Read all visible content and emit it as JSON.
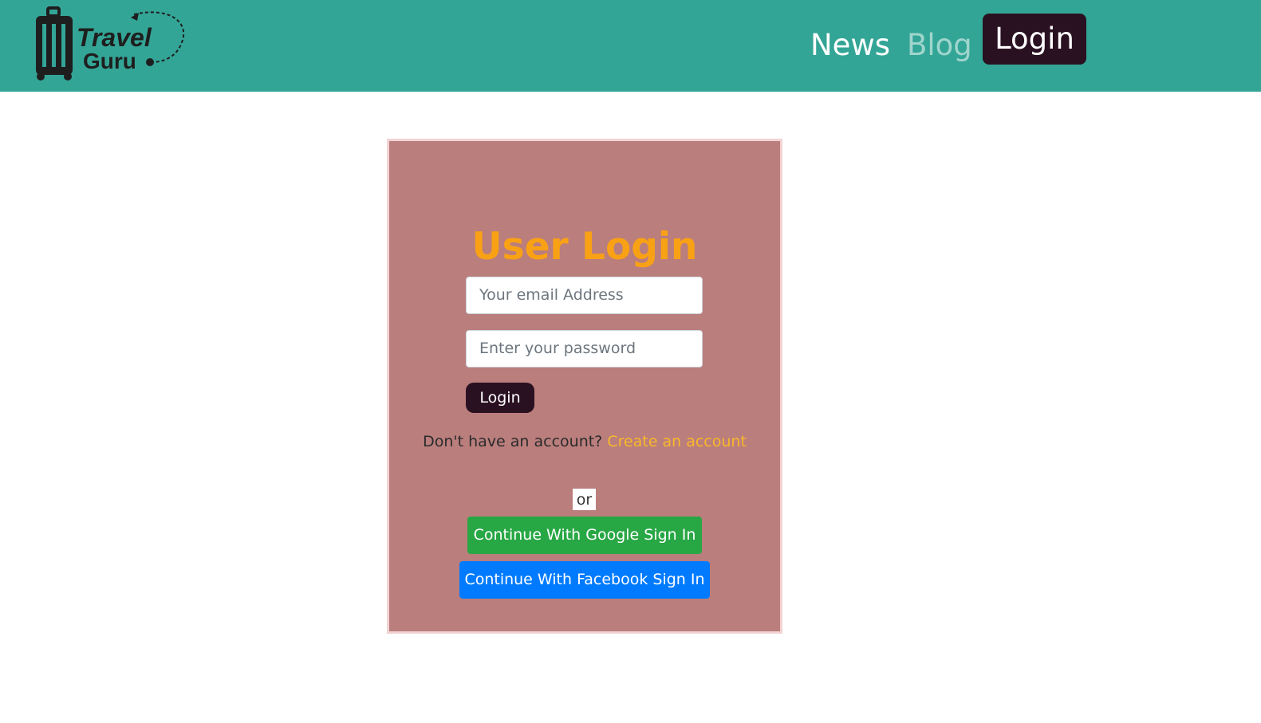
{
  "header": {
    "logo": {
      "line1": "Travel",
      "line2": "Guru"
    },
    "nav": {
      "news": "News",
      "blog": "Blog",
      "login": "Login"
    }
  },
  "login_card": {
    "title": "User Login",
    "email_placeholder": "Your  email Address",
    "password_placeholder": "Enter your password",
    "login_button": "Login",
    "no_account_text": "Don't have an account? ",
    "create_account_link": "Create an account",
    "or_text": "or",
    "google_button": "Continue With Google Sign In",
    "facebook_button": "Continue With Facebook Sign In"
  },
  "colors": {
    "navbar_bg": "#33a596",
    "card_bg": "#ba7e7d",
    "title_color": "#f9a115",
    "button_dark": "#2a1121",
    "google_green": "#28a745",
    "facebook_blue": "#007bff"
  }
}
